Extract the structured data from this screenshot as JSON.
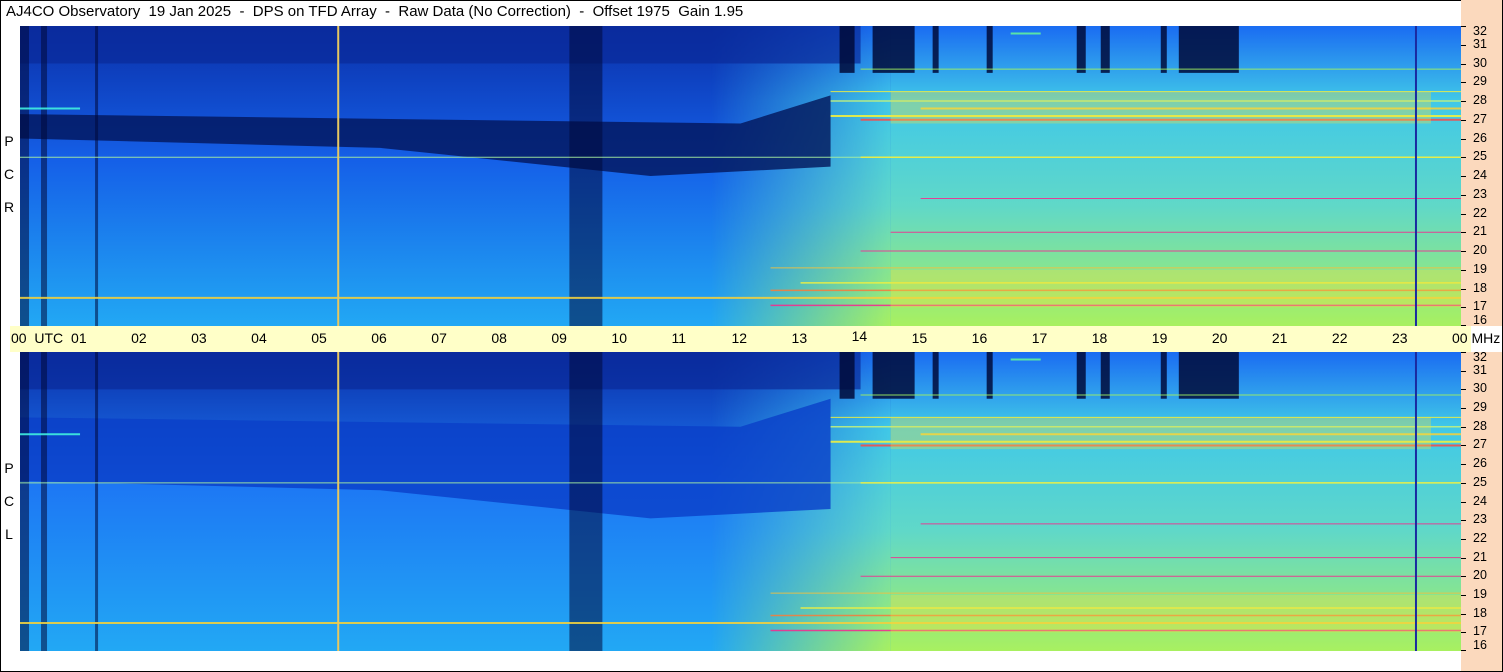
{
  "header": {
    "title": "AJ4CO Observatory  19 Jan 2025  -  DPS on TFD Array  -  Raw Data (No Correction)  -  Offset 1975  Gain 1.95"
  },
  "panels": {
    "rcp": {
      "label_letters": [
        "P",
        "C",
        "R"
      ]
    },
    "lcp": {
      "label_letters": [
        "P",
        "C",
        "L"
      ]
    }
  },
  "colors": {
    "background_low": "#000b3a",
    "mid_blue": "#1a5ff0",
    "cyan": "#19c0f0",
    "green_yellow": "#a0f060",
    "yellow": "#f0f040",
    "magenta": "#f020a0",
    "marker_line": "#e8c860",
    "axis_bg": "#ffffc8",
    "freq_axis_bg": "#fbd9bd"
  },
  "chart_data": [
    {
      "type": "heatmap",
      "name": "RCP",
      "xlabel": "UTC",
      "ylabel": "MHz",
      "x_ticks": [
        "00",
        "01",
        "02",
        "03",
        "04",
        "05",
        "06",
        "07",
        "08",
        "09",
        "10",
        "11",
        "12",
        "13",
        "14",
        "15",
        "16",
        "17",
        "18",
        "19",
        "20",
        "21",
        "22",
        "23",
        "00"
      ],
      "xlim": [
        0,
        24
      ],
      "y_ticks": [
        16,
        17,
        18,
        19,
        20,
        21,
        22,
        23,
        24,
        25,
        26,
        27,
        28,
        29,
        30,
        31,
        32
      ],
      "ylim": [
        16,
        32
      ],
      "vertical_markers_utc": [
        5.3,
        23.25
      ]
    },
    {
      "type": "heatmap",
      "name": "LCP",
      "xlabel": "UTC",
      "ylabel": "MHz",
      "x_ticks": [
        "00",
        "01",
        "02",
        "03",
        "04",
        "05",
        "06",
        "07",
        "08",
        "09",
        "10",
        "11",
        "12",
        "13",
        "14",
        "15",
        "16",
        "17",
        "18",
        "19",
        "20",
        "21",
        "22",
        "23",
        "00"
      ],
      "xlim": [
        0,
        24
      ],
      "y_ticks": [
        16,
        17,
        18,
        19,
        20,
        21,
        22,
        23,
        24,
        25,
        26,
        27,
        28,
        29,
        30,
        31,
        32
      ],
      "ylim": [
        16,
        32
      ],
      "vertical_markers_utc": [
        5.3,
        23.25
      ]
    }
  ],
  "axis": {
    "utc_label": "UTC",
    "mhz_label": "MHz"
  }
}
